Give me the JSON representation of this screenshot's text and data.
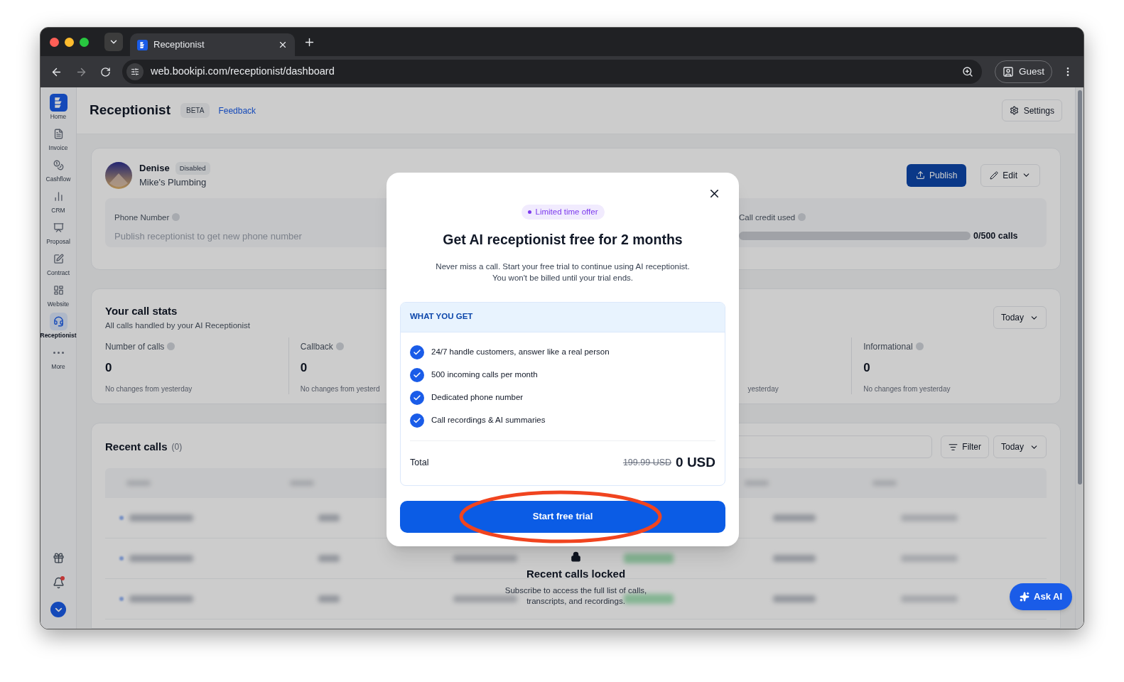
{
  "browser": {
    "tab_title": "Receptionist",
    "url": "web.bookipi.com/receptionist/dashboard",
    "profile": "Guest"
  },
  "sidebar": {
    "items": [
      {
        "kind": "home",
        "label": "Home",
        "selected": false
      },
      {
        "kind": "invoice",
        "label": "Invoice",
        "selected": false
      },
      {
        "kind": "cashflow",
        "label": "Cashflow",
        "selected": false
      },
      {
        "kind": "crm",
        "label": "CRM",
        "selected": false
      },
      {
        "kind": "proposal",
        "label": "Proposal",
        "selected": false
      },
      {
        "kind": "contract",
        "label": "Contract",
        "selected": false
      },
      {
        "kind": "website",
        "label": "Website",
        "selected": false
      },
      {
        "kind": "receptionist",
        "label": "Receptionist",
        "selected": true
      },
      {
        "kind": "more",
        "label": "More",
        "selected": false
      }
    ],
    "notifications": true
  },
  "header": {
    "title": "Receptionist",
    "badge": "BETA",
    "link": "Feedback",
    "settings": "Settings"
  },
  "agent": {
    "name": "Denise",
    "status": "Disabled",
    "business": "Mike's Plumbing",
    "publish": "Publish",
    "edit": "Edit",
    "phone_label": "Phone Number",
    "phone_text": "Publish receptionist to get new phone number",
    "credit_label": "Call credit used",
    "credit_reading": "0/500 calls",
    "level": 0
  },
  "stats": {
    "title": "Your call stats",
    "subtitle": "All calls handled by your AI Receptionist",
    "period": "Today",
    "items": [
      {
        "kind": "full",
        "label": "Number of calls",
        "value": "0",
        "note": "No changes from yesterday"
      },
      {
        "kind": "full",
        "label": "Callback",
        "value": "0",
        "note": "No changes from yesterd"
      },
      {
        "kind": "hidden"
      },
      {
        "kind": "clipped",
        "note": "yesterday"
      },
      {
        "kind": "full",
        "label": "Informational",
        "value": "0",
        "note": "No changes from yesterday"
      }
    ]
  },
  "recent": {
    "title": "Recent calls",
    "count": "(0)",
    "filter": "Filter",
    "period": "Today",
    "locked_title": "Recent calls locked",
    "locked_text": "Subscribe to access the full list of calls, transcripts, and recordings."
  },
  "ask_ai": "Ask AI",
  "modal": {
    "badge": "Limited time offer",
    "title": "Get AI receptionist free for 2 months",
    "description": [
      "Never miss a call. Start your free trial to continue using AI receptionist.",
      "You won't be billed until your trial ends."
    ],
    "section": "WHAT YOU GET",
    "features": [
      "24/7 handle customers, answer like a real person",
      "500 incoming calls per month",
      "Dedicated phone number",
      "Call recordings & AI summaries"
    ],
    "total_label": "Total",
    "old_price": "199.99 USD",
    "price": "0 USD",
    "cta": "Start free trial"
  }
}
